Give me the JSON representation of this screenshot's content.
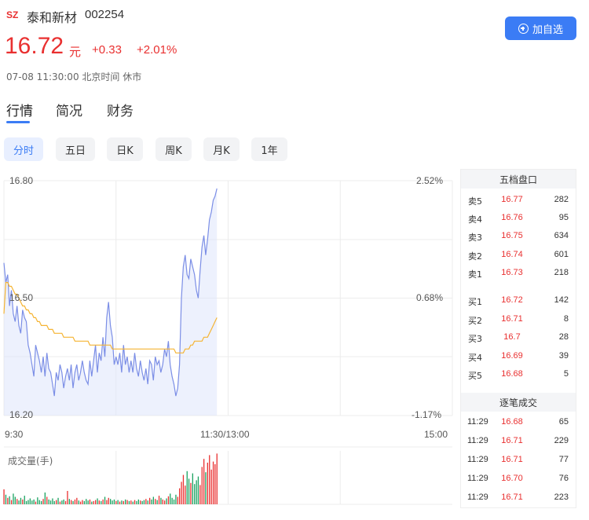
{
  "header": {
    "market_badge": "SZ",
    "stock_name": "泰和新材",
    "stock_code": "002254",
    "price": "16.72",
    "unit": "元",
    "change": "+0.33",
    "change_pct": "+2.01%",
    "time_info": "07-08 11:30:00 北京时间 休市",
    "add_button_label": "加自选",
    "accent_color": "#3b7cf5",
    "up_color": "#e93030"
  },
  "tabs": [
    {
      "label": "行情",
      "active": true
    },
    {
      "label": "简况",
      "active": false
    },
    {
      "label": "财务",
      "active": false
    }
  ],
  "periods": [
    {
      "label": "分时",
      "active": true
    },
    {
      "label": "五日",
      "active": false
    },
    {
      "label": "日K",
      "active": false
    },
    {
      "label": "周K",
      "active": false
    },
    {
      "label": "月K",
      "active": false
    },
    {
      "label": "1年",
      "active": false
    }
  ],
  "chart_data": {
    "type": "line",
    "y_left_ticks": [
      "16.80",
      "16.50",
      "16.20"
    ],
    "y_right_ticks": [
      "2.52%",
      "0.68%",
      "-1.17%"
    ],
    "ylim": [
      16.2,
      16.8
    ],
    "x_ticks": [
      "9:30",
      "11:30/13:00",
      "15:00"
    ],
    "total_minutes": 240,
    "grid": true,
    "series": [
      {
        "role": "price",
        "color": "#7b8ee6",
        "values": [
          16.59,
          16.54,
          16.56,
          16.48,
          16.52,
          16.46,
          16.44,
          16.48,
          16.43,
          16.41,
          16.47,
          16.45,
          16.44,
          16.38,
          16.36,
          16.33,
          16.3,
          16.38,
          16.36,
          16.34,
          16.31,
          16.35,
          16.3,
          16.36,
          16.32,
          16.31,
          16.28,
          16.25,
          16.31,
          16.29,
          16.33,
          16.31,
          16.27,
          16.3,
          16.32,
          16.29,
          16.33,
          16.27,
          16.31,
          16.33,
          16.29,
          16.31,
          16.34,
          16.31,
          16.29,
          16.28,
          16.34,
          16.3,
          16.34,
          16.38,
          16.31,
          16.36,
          16.34,
          16.4,
          16.35,
          16.45,
          16.49,
          16.43,
          16.4,
          16.33,
          16.35,
          16.33,
          16.36,
          16.31,
          16.38,
          16.33,
          16.35,
          16.31,
          16.34,
          16.31,
          16.36,
          16.32,
          16.3,
          16.34,
          16.31,
          16.29,
          16.32,
          16.28,
          16.34,
          16.33,
          16.29,
          16.35,
          16.33,
          16.34,
          16.31,
          16.33,
          16.37,
          16.35,
          16.39,
          16.33,
          16.3,
          16.28,
          16.25,
          16.27,
          16.33,
          16.5,
          16.58,
          16.61,
          16.56,
          16.55,
          16.6,
          16.58,
          16.56,
          16.52,
          16.5,
          16.57,
          16.63,
          16.66,
          16.61,
          16.65,
          16.7,
          16.72,
          16.75,
          16.76,
          16.78
        ],
        "area": true
      },
      {
        "role": "average",
        "color": "#f5b433",
        "values": [
          16.46,
          16.54,
          16.54,
          16.53,
          16.53,
          16.52,
          16.51,
          16.51,
          16.5,
          16.49,
          16.48,
          16.48,
          16.47,
          16.47,
          16.46,
          16.46,
          16.45,
          16.45,
          16.44,
          16.44,
          16.43,
          16.43,
          16.43,
          16.43,
          16.42,
          16.42,
          16.42,
          16.41,
          16.41,
          16.41,
          16.41,
          16.41,
          16.4,
          16.4,
          16.4,
          16.4,
          16.4,
          16.4,
          16.39,
          16.39,
          16.39,
          16.39,
          16.39,
          16.39,
          16.39,
          16.39,
          16.38,
          16.38,
          16.38,
          16.38,
          16.38,
          16.38,
          16.38,
          16.38,
          16.38,
          16.38,
          16.38,
          16.38,
          16.37,
          16.37,
          16.37,
          16.37,
          16.37,
          16.37,
          16.37,
          16.37,
          16.37,
          16.37,
          16.37,
          16.37,
          16.37,
          16.37,
          16.37,
          16.37,
          16.37,
          16.37,
          16.37,
          16.37,
          16.37,
          16.37,
          16.37,
          16.37,
          16.37,
          16.37,
          16.37,
          16.37,
          16.37,
          16.37,
          16.37,
          16.37,
          16.37,
          16.37,
          16.36,
          16.36,
          16.36,
          16.36,
          16.36,
          16.37,
          16.37,
          16.37,
          16.38,
          16.38,
          16.39,
          16.39,
          16.39,
          16.39,
          16.39,
          16.4,
          16.4,
          16.4,
          16.41,
          16.42,
          16.43,
          16.44,
          16.45
        ],
        "area": false
      }
    ],
    "volume": {
      "title": "成交量(手)",
      "max": 100,
      "values": [
        28,
        18,
        12,
        15,
        8,
        20,
        14,
        10,
        7,
        12,
        9,
        16,
        6,
        8,
        11,
        7,
        9,
        5,
        13,
        8,
        6,
        10,
        22,
        14,
        9,
        7,
        11,
        6,
        8,
        12,
        5,
        7,
        9,
        6,
        25,
        10,
        8,
        6,
        9,
        12,
        7,
        5,
        8,
        6,
        10,
        7,
        9,
        5,
        6,
        8,
        11,
        7,
        6,
        9,
        14,
        8,
        12,
        10,
        7,
        9,
        6,
        8,
        5,
        7,
        6,
        9,
        8,
        6,
        7,
        5,
        8,
        6,
        9,
        7,
        6,
        8,
        10,
        7,
        12,
        9,
        14,
        10,
        8,
        16,
        12,
        9,
        7,
        11,
        15,
        20,
        12,
        9,
        18,
        14,
        30,
        42,
        55,
        35,
        62,
        48,
        40,
        58,
        38,
        45,
        52,
        36,
        70,
        85,
        60,
        78,
        92,
        65,
        80,
        75,
        95
      ],
      "colors": {
        "up": "#e93030",
        "down": "#1aa260"
      }
    }
  },
  "order_book": {
    "title": "五档盘口",
    "sell": [
      {
        "label": "卖5",
        "price": "16.77",
        "volume": "282"
      },
      {
        "label": "卖4",
        "price": "16.76",
        "volume": "95"
      },
      {
        "label": "卖3",
        "price": "16.75",
        "volume": "634"
      },
      {
        "label": "卖2",
        "price": "16.74",
        "volume": "601"
      },
      {
        "label": "卖1",
        "price": "16.73",
        "volume": "218"
      }
    ],
    "buy": [
      {
        "label": "买1",
        "price": "16.72",
        "volume": "142"
      },
      {
        "label": "买2",
        "price": "16.71",
        "volume": "8"
      },
      {
        "label": "买3",
        "price": "16.7",
        "volume": "28"
      },
      {
        "label": "买4",
        "price": "16.69",
        "volume": "39"
      },
      {
        "label": "买5",
        "price": "16.68",
        "volume": "5"
      }
    ]
  },
  "trades": {
    "title": "逐笔成交",
    "rows": [
      {
        "time": "11:29",
        "price": "16.68",
        "volume": "65"
      },
      {
        "time": "11:29",
        "price": "16.71",
        "volume": "229"
      },
      {
        "time": "11:29",
        "price": "16.71",
        "volume": "77"
      },
      {
        "time": "11:29",
        "price": "16.70",
        "volume": "76"
      },
      {
        "time": "11:29",
        "price": "16.71",
        "volume": "223"
      }
    ]
  }
}
